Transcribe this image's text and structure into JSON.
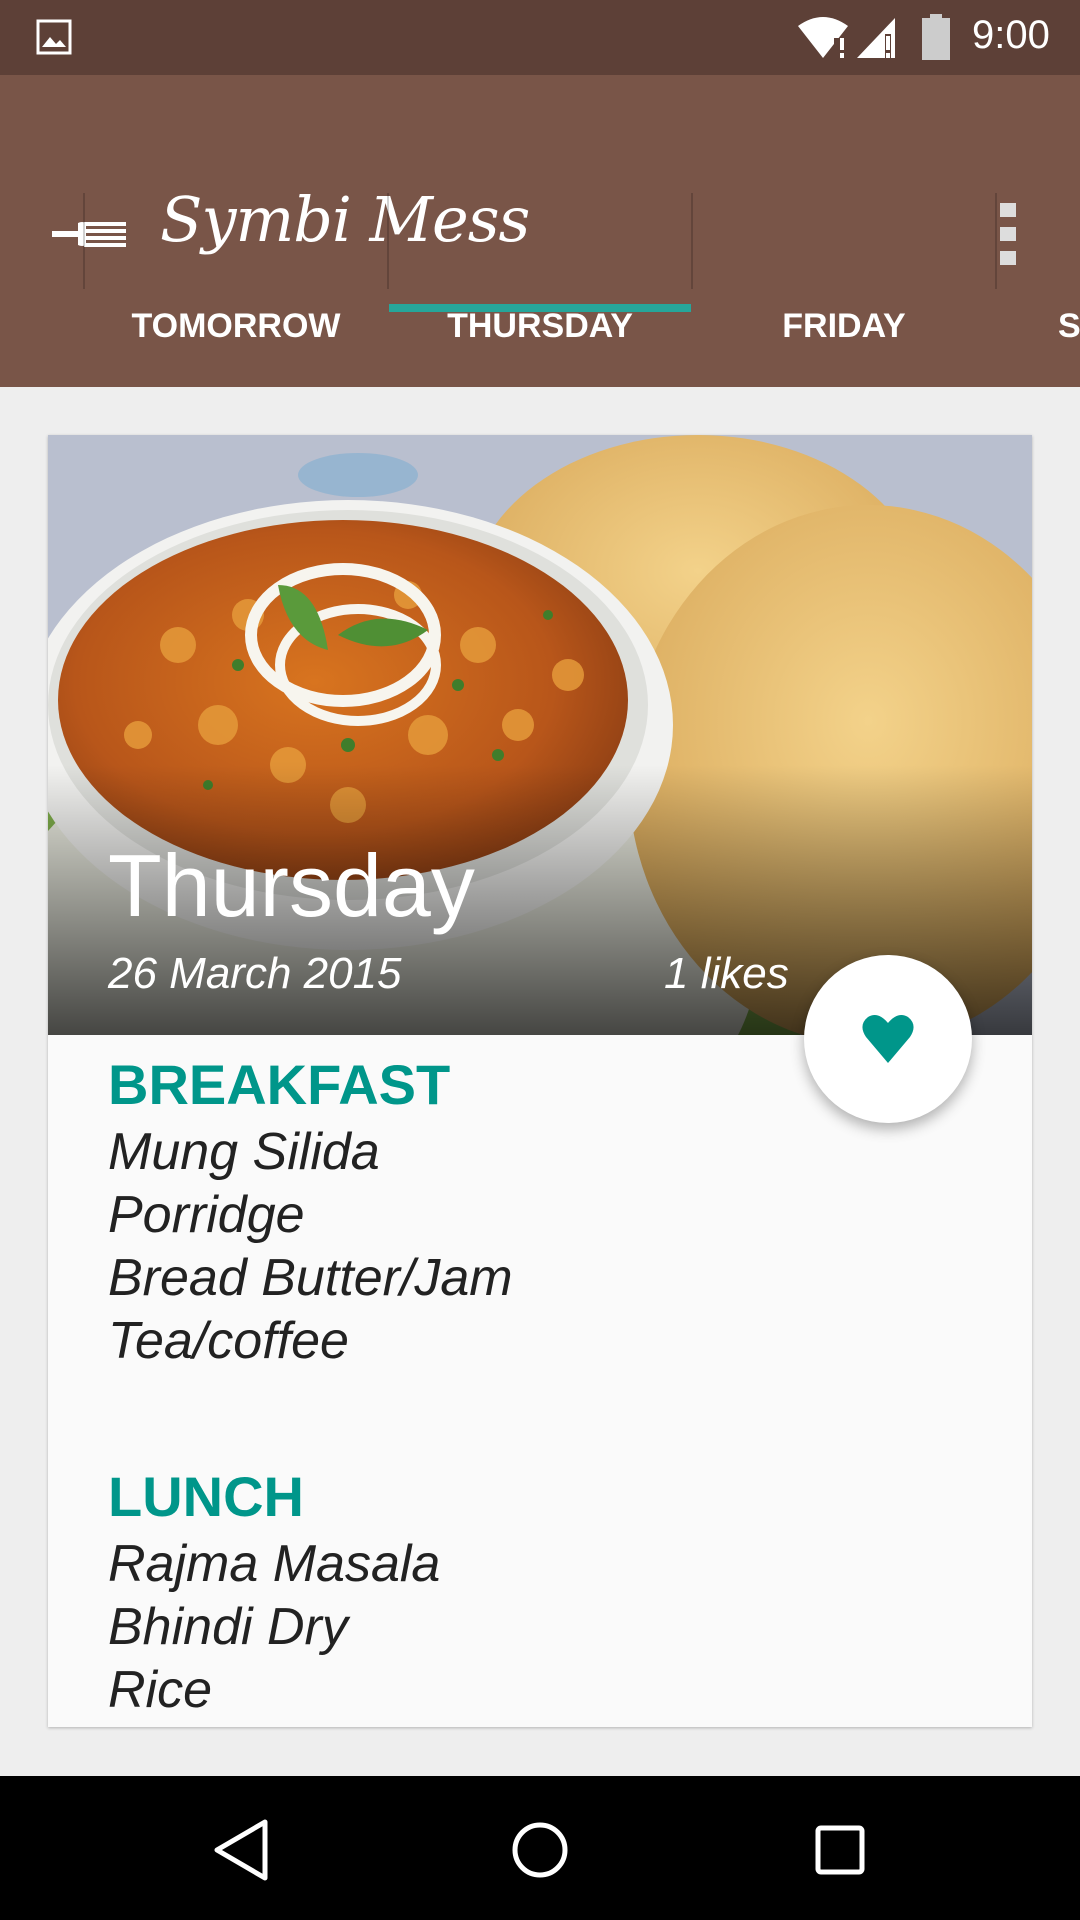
{
  "status_bar": {
    "time": "9:00"
  },
  "app_bar": {
    "title": "Symbi Mess"
  },
  "tabs": [
    {
      "label": "TOMORROW"
    },
    {
      "label": "THURSDAY",
      "selected": true
    },
    {
      "label": "FRIDAY"
    },
    {
      "label": "S"
    }
  ],
  "card": {
    "day": "Thursday",
    "date": "26 March 2015",
    "likes": "1 likes",
    "sections": [
      {
        "title": "BREAKFAST",
        "items": [
          "Mung Silida",
          "Porridge",
          "Bread Butter/Jam",
          "Tea/coffee"
        ]
      },
      {
        "title": "LUNCH",
        "items": [
          "Rajma Masala",
          "Bhindi Dry",
          "Rice"
        ]
      }
    ]
  },
  "colors": {
    "primary_dark": "#5d4037",
    "primary": "#795548",
    "accent": "#00968a",
    "indicator": "#26a69a"
  },
  "icons": {
    "fab": "heart-icon",
    "nav": [
      "back-icon",
      "home-icon",
      "recents-icon"
    ]
  }
}
